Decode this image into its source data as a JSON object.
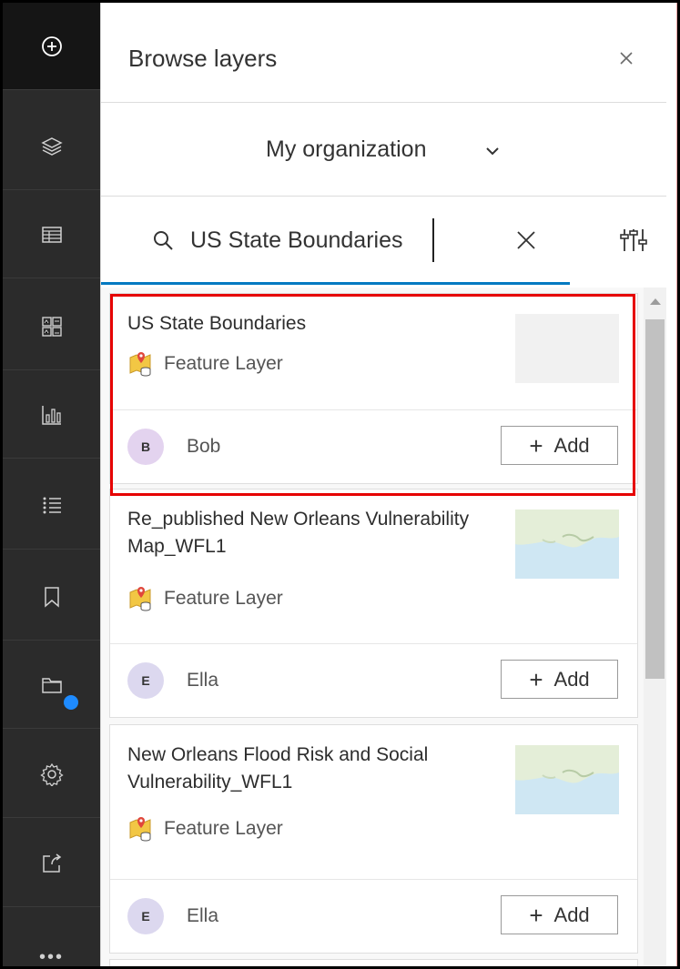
{
  "toolbar": {
    "items": [
      {
        "name": "add-icon"
      },
      {
        "name": "layers-icon"
      },
      {
        "name": "table-icon"
      },
      {
        "name": "legend-icon"
      },
      {
        "name": "chart-icon"
      },
      {
        "name": "list-icon"
      },
      {
        "name": "bookmark-icon"
      },
      {
        "name": "folder-icon"
      },
      {
        "name": "gear-icon"
      },
      {
        "name": "share-icon"
      },
      {
        "name": "more-icon"
      }
    ],
    "more_label": "•••"
  },
  "panel": {
    "title": "Browse layers",
    "source_label": "My organization"
  },
  "search": {
    "value": "US State Boundaries",
    "placeholder": ""
  },
  "results": [
    {
      "title": "US State Boundaries",
      "type": "Feature Layer",
      "owner": "Bob",
      "initial": "B",
      "add_label": "Add",
      "thumbnail": "blank"
    },
    {
      "title": "Re_published New Orleans Vulnerability Map_WFL1",
      "type": "Feature Layer",
      "owner": "Ella",
      "initial": "E",
      "add_label": "Add",
      "thumbnail": "map"
    },
    {
      "title": "New Orleans Flood Risk and Social Vulnerability_WFL1",
      "type": "Feature Layer",
      "owner": "Ella",
      "initial": "E",
      "add_label": "Add",
      "thumbnail": "map"
    }
  ],
  "colors": {
    "toolbar_bg": "#2b2b2b",
    "accent": "#0079c1",
    "highlight": "#e60000",
    "notification_dot": "#1e8bff"
  }
}
